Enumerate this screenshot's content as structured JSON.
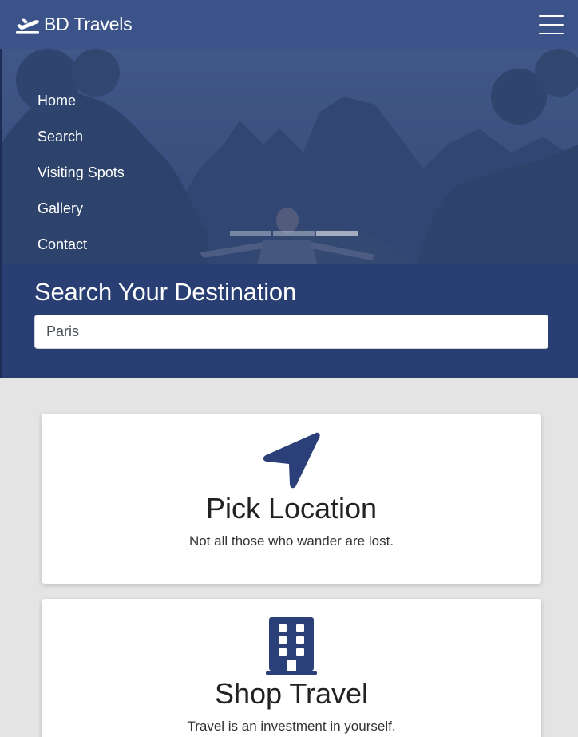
{
  "header": {
    "brand": "BD Travels",
    "brand_icon": "plane-departure-icon",
    "menu_icon": "hamburger-menu-icon"
  },
  "nav": {
    "items": [
      {
        "label": "Home"
      },
      {
        "label": "Search"
      },
      {
        "label": "Visiting Spots"
      },
      {
        "label": "Gallery"
      },
      {
        "label": "Contact"
      }
    ]
  },
  "carousel": {
    "slides": 3,
    "active": 2
  },
  "search": {
    "title": "Search Your Destination",
    "value": "Paris"
  },
  "cards": [
    {
      "icon": "location-arrow-icon",
      "title": "Pick Location",
      "text": "Not all those who wander are lost."
    },
    {
      "icon": "building-icon",
      "title": "Shop Travel",
      "text": "Travel is an investment in yourself."
    }
  ],
  "colors": {
    "header": "#3b5389",
    "hero_overlay": "#304882",
    "search_band": "#293f74",
    "accent": "#2b3f78",
    "page_bg": "#e4e4e4"
  }
}
